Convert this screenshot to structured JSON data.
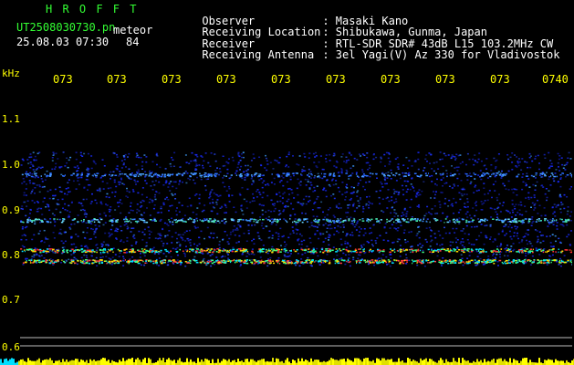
{
  "header": {
    "app_title": "H R O F F T",
    "filename": "UT2508030730.pn",
    "meteor_label": "meteor",
    "date_time": "25.08.03 07:30",
    "count": "84"
  },
  "info": [
    {
      "label": "Observer",
      "value": ": Masaki Kano"
    },
    {
      "label": "Receiving Location",
      "value": ": Shibukawa, Gunma, Japan"
    },
    {
      "label": "Receiver",
      "value": ": RTL-SDR SDR# 43dB L15 103.2MHz CW"
    },
    {
      "label": "Receiving Antenna",
      "value": ": 3el Yagi(V) Az 330 for Vladivostok"
    }
  ],
  "axis": {
    "unit": "kHz",
    "time_ticks": [
      "073",
      "073",
      "073",
      "073",
      "073",
      "073",
      "073",
      "073",
      "073",
      "0740"
    ],
    "freq_ticks": [
      "1.1",
      "1.0",
      "0.9",
      "0.8",
      "0.7",
      "0.6"
    ]
  },
  "colors": {
    "background": "#000000",
    "title_green": "#33ff33",
    "label_yellow": "#ffff00",
    "text_white": "#ffffff",
    "noise_blue": "#1a2cff",
    "baseline_cyan": "#00e0ff"
  }
}
